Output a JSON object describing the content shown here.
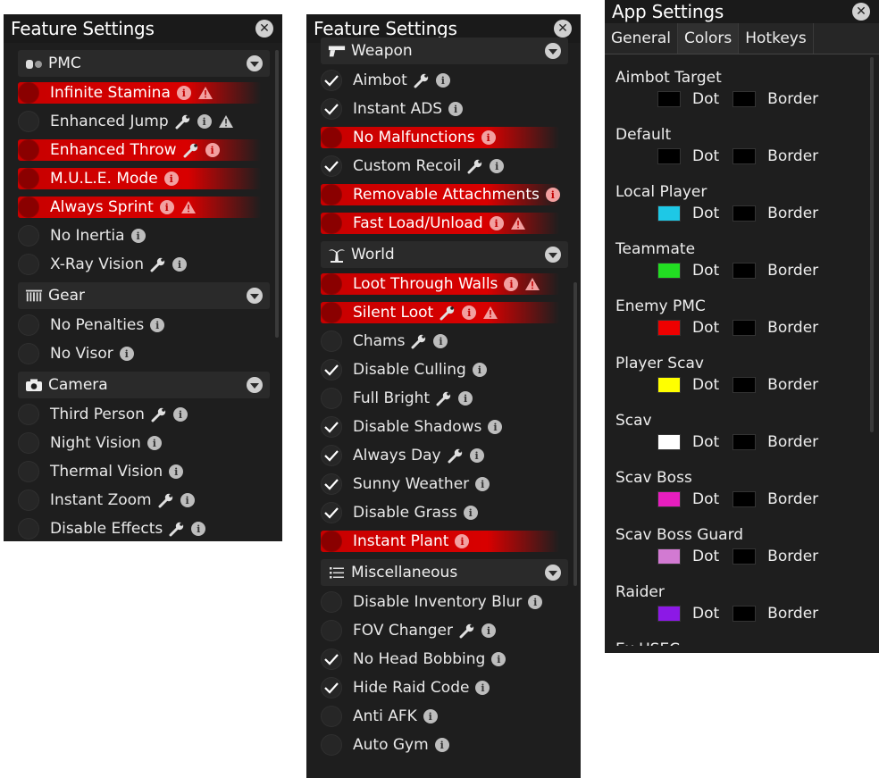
{
  "panel1": {
    "title": "Feature Settings",
    "sections": [
      {
        "label": "PMC",
        "icon": "pill-icon",
        "items": [
          {
            "label": "Infinite Stamina",
            "checked": false,
            "highlight": true,
            "icons": [
              "info",
              "warn"
            ]
          },
          {
            "label": "Enhanced Jump",
            "checked": false,
            "highlight": false,
            "icons": [
              "wrench",
              "info",
              "warn"
            ]
          },
          {
            "label": "Enhanced Throw",
            "checked": false,
            "highlight": true,
            "icons": [
              "wrench",
              "info"
            ]
          },
          {
            "label": "M.U.L.E. Mode",
            "checked": false,
            "highlight": true,
            "icons": [
              "info"
            ]
          },
          {
            "label": "Always Sprint",
            "checked": false,
            "highlight": true,
            "icons": [
              "info",
              "warn"
            ]
          },
          {
            "label": "No Inertia",
            "checked": false,
            "highlight": false,
            "icons": [
              "info"
            ]
          },
          {
            "label": "X-Ray Vision",
            "checked": false,
            "highlight": false,
            "icons": [
              "wrench",
              "info"
            ]
          }
        ]
      },
      {
        "label": "Gear",
        "icon": "gear-rack-icon",
        "items": [
          {
            "label": "No Penalties",
            "checked": false,
            "highlight": false,
            "icons": [
              "info"
            ]
          },
          {
            "label": "No Visor",
            "checked": false,
            "highlight": false,
            "icons": [
              "info"
            ]
          }
        ]
      },
      {
        "label": "Camera",
        "icon": "camera-icon",
        "items": [
          {
            "label": "Third Person",
            "checked": false,
            "highlight": false,
            "icons": [
              "wrench",
              "info"
            ]
          },
          {
            "label": "Night Vision",
            "checked": false,
            "highlight": false,
            "icons": [
              "info"
            ]
          },
          {
            "label": "Thermal Vision",
            "checked": false,
            "highlight": false,
            "icons": [
              "info"
            ]
          },
          {
            "label": "Instant Zoom",
            "checked": false,
            "highlight": false,
            "icons": [
              "wrench",
              "info"
            ]
          },
          {
            "label": "Disable Effects",
            "checked": false,
            "highlight": false,
            "icons": [
              "wrench",
              "info"
            ]
          }
        ]
      }
    ]
  },
  "panel2": {
    "title": "Feature Settings",
    "sections": [
      {
        "label": "Weapon",
        "icon": "pistol-icon",
        "items": [
          {
            "label": "Aimbot",
            "checked": true,
            "highlight": false,
            "icons": [
              "wrench",
              "info"
            ]
          },
          {
            "label": "Instant ADS",
            "checked": true,
            "highlight": false,
            "icons": [
              "info"
            ]
          },
          {
            "label": "No Malfunctions",
            "checked": false,
            "highlight": true,
            "icons": [
              "info"
            ]
          },
          {
            "label": "Custom Recoil",
            "checked": true,
            "highlight": false,
            "icons": [
              "wrench",
              "info"
            ]
          },
          {
            "label": "Removable Attachments",
            "checked": false,
            "highlight": true,
            "icons": [
              "info"
            ]
          },
          {
            "label": "Fast Load/Unload",
            "checked": false,
            "highlight": true,
            "icons": [
              "info",
              "warn"
            ]
          }
        ]
      },
      {
        "label": "World",
        "icon": "palm-tree-icon",
        "items": [
          {
            "label": "Loot Through Walls",
            "checked": false,
            "highlight": true,
            "icons": [
              "info",
              "warn"
            ]
          },
          {
            "label": "Silent Loot",
            "checked": false,
            "highlight": true,
            "icons": [
              "wrench",
              "info",
              "warn"
            ]
          },
          {
            "label": "Chams",
            "checked": false,
            "highlight": false,
            "icons": [
              "wrench",
              "info"
            ]
          },
          {
            "label": "Disable Culling",
            "checked": true,
            "highlight": false,
            "icons": [
              "info"
            ]
          },
          {
            "label": "Full Bright",
            "checked": false,
            "highlight": false,
            "icons": [
              "wrench",
              "info"
            ]
          },
          {
            "label": "Disable Shadows",
            "checked": true,
            "highlight": false,
            "icons": [
              "info"
            ]
          },
          {
            "label": "Always Day",
            "checked": true,
            "highlight": false,
            "icons": [
              "wrench",
              "info"
            ]
          },
          {
            "label": "Sunny Weather",
            "checked": true,
            "highlight": false,
            "icons": [
              "info"
            ]
          },
          {
            "label": "Disable Grass",
            "checked": true,
            "highlight": false,
            "icons": [
              "info"
            ]
          },
          {
            "label": "Instant Plant",
            "checked": false,
            "highlight": true,
            "icons": [
              "info"
            ]
          }
        ]
      },
      {
        "label": "Miscellaneous",
        "icon": "list-icon",
        "items": [
          {
            "label": "Disable Inventory Blur",
            "checked": false,
            "highlight": false,
            "icons": [
              "info"
            ]
          },
          {
            "label": "FOV Changer",
            "checked": false,
            "highlight": false,
            "icons": [
              "wrench",
              "info"
            ]
          },
          {
            "label": "No Head Bobbing",
            "checked": true,
            "highlight": false,
            "icons": [
              "info"
            ]
          },
          {
            "label": "Hide Raid Code",
            "checked": true,
            "highlight": false,
            "icons": [
              "info"
            ]
          },
          {
            "label": "Anti AFK",
            "checked": false,
            "highlight": false,
            "icons": [
              "info"
            ]
          },
          {
            "label": "Auto Gym",
            "checked": false,
            "highlight": false,
            "icons": [
              "info"
            ]
          }
        ]
      }
    ]
  },
  "panel3": {
    "title": "App Settings",
    "tabs": [
      {
        "label": "General",
        "active": false
      },
      {
        "label": "Colors",
        "active": true
      },
      {
        "label": "Hotkeys",
        "active": false
      }
    ],
    "dot_label": "Dot",
    "border_label": "Border",
    "colors": [
      {
        "name": "Aimbot Target",
        "dot": "#000000",
        "border": "#000000"
      },
      {
        "name": "Default",
        "dot": "#000000",
        "border": "#000000"
      },
      {
        "name": "Local Player",
        "dot": "#1ec8e6",
        "border": "#000000"
      },
      {
        "name": "Teammate",
        "dot": "#22dd22",
        "border": "#000000"
      },
      {
        "name": "Enemy PMC",
        "dot": "#ee0000",
        "border": "#000000"
      },
      {
        "name": "Player Scav",
        "dot": "#ffff00",
        "border": "#000000"
      },
      {
        "name": "Scav",
        "dot": "#ffffff",
        "border": "#000000"
      },
      {
        "name": "Scav Boss",
        "dot": "#e61ebe",
        "border": "#000000"
      },
      {
        "name": "Scav Boss Guard",
        "dot": "#d27ad2",
        "border": "#000000"
      },
      {
        "name": "Raider",
        "dot": "#8c19e6",
        "border": "#000000"
      },
      {
        "name": "Ex USEC",
        "dot": "#000000",
        "border": "#000000"
      }
    ]
  },
  "theme": {
    "highlight": "#d40000",
    "panel_bg": "#1e1e1e",
    "section_bg": "#2a2a2a"
  }
}
